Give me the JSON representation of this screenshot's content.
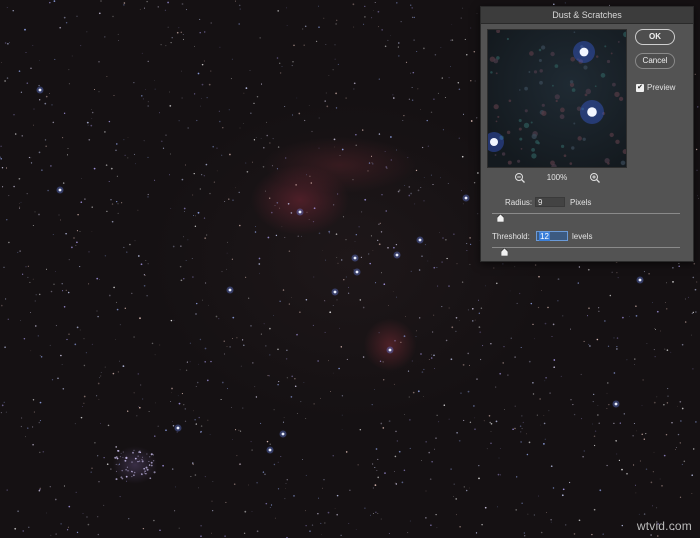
{
  "dialog": {
    "title": "Dust & Scratches",
    "ok_label": "OK",
    "cancel_label": "Cancel",
    "preview_label": "Preview",
    "preview_checked": true,
    "zoom_level": "100%",
    "radius": {
      "label": "Radius:",
      "value": "9",
      "unit": "Pixels",
      "slider_fraction": 0.04
    },
    "threshold": {
      "label": "Threshold:",
      "value": "12",
      "unit": "levels",
      "slider_fraction": 0.05
    }
  },
  "watermark": "wtvid.com",
  "icons": {
    "zoom_out": "zoom-out-icon",
    "zoom_in": "zoom-in-icon",
    "checkbox": "checkmark-icon",
    "slider_thumb": "slider-thumb-icon"
  },
  "colors": {
    "dialog_bg": "#535353",
    "titlebar_bg": "#3c3c3c",
    "field_focus": "#3b7fd9",
    "sky_bg": "#141012",
    "nebula": "#78283a"
  }
}
